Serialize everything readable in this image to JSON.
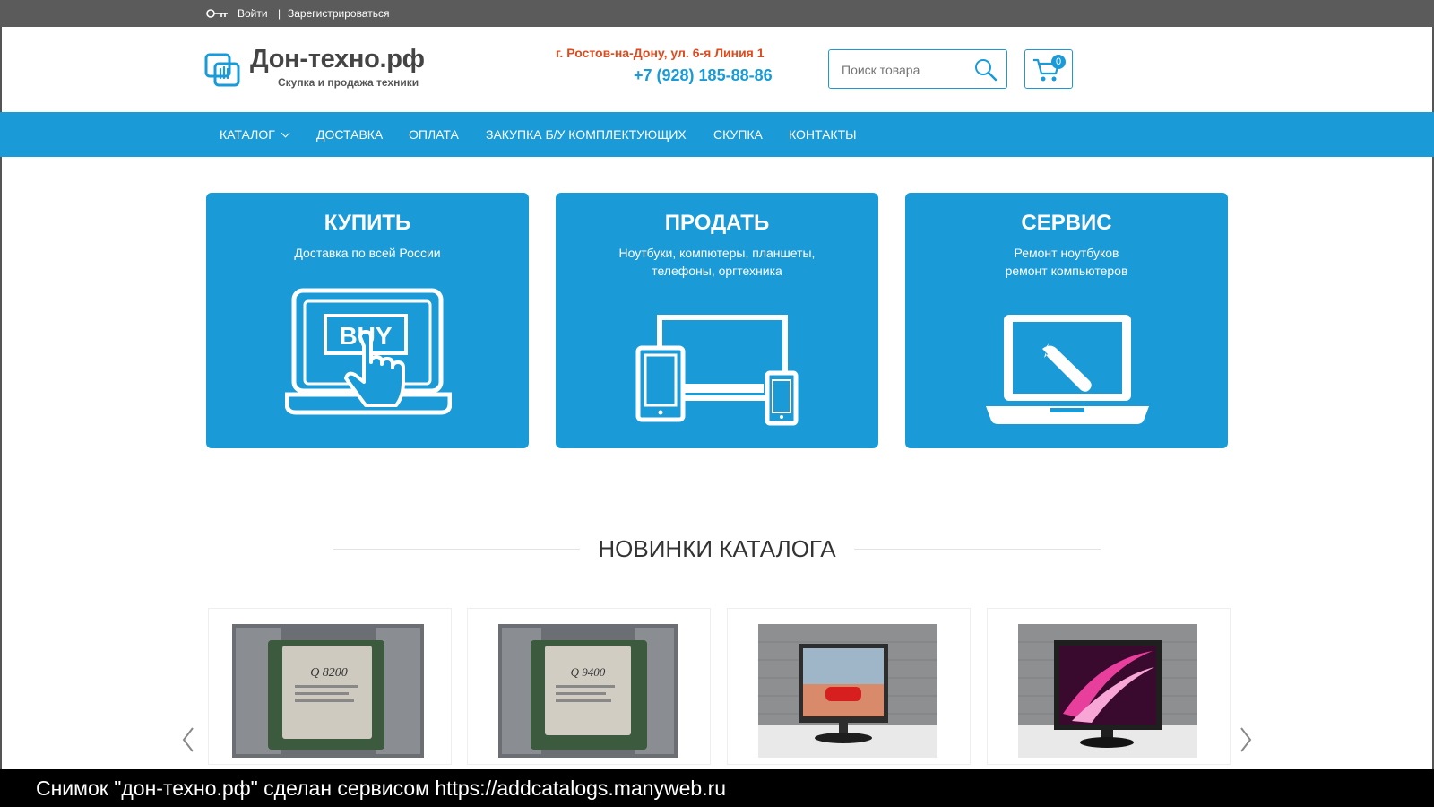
{
  "topbar": {
    "login": "Войти",
    "separator": "|",
    "register": "Зарегистрироваться"
  },
  "header": {
    "logo_title": "Дон-техно.рф",
    "logo_subtitle": "Скупка и продажа техники",
    "address": "г. Ростов-на-Дону, ул. 6-я Линия 1",
    "phone": "+7 (928) 185-88-86"
  },
  "search": {
    "placeholder": "Поиск товара"
  },
  "cart": {
    "count": "0"
  },
  "nav": {
    "items": [
      "КАТАЛОГ",
      "ДОСТАВКА",
      "ОПЛАТА",
      "ЗАКУПКА Б/У КОМПЛЕКТУЮЩИХ",
      "СКУПКА",
      "КОНТАКТЫ"
    ]
  },
  "cards": [
    {
      "title": "КУПИТЬ",
      "desc1": "Доставка по всей России",
      "desc2": "",
      "badge": "BUY"
    },
    {
      "title": "ПРОДАТЬ",
      "desc1": "Ноутбуки, компютеры, планшеты,",
      "desc2": "телефоны, оргтехника"
    },
    {
      "title": "СЕРВИС",
      "desc1": "Ремонт ноутбуков",
      "desc2": "ремонт компьютеров"
    }
  ],
  "section": {
    "title": "НОВИНКИ КАТАЛОГА"
  },
  "products": [
    {
      "chip_label": "Q 8200"
    },
    {
      "chip_label": "Q 9400"
    },
    {
      "chip_label": ""
    },
    {
      "chip_label": ""
    }
  ],
  "caption": "Снимок \"дон-техно.рф\" сделан сервисом https://addcatalogs.manyweb.ru",
  "colors": {
    "accent": "#1a9ad6",
    "address": "#e04a1d",
    "topbar": "#5b5b5b"
  }
}
